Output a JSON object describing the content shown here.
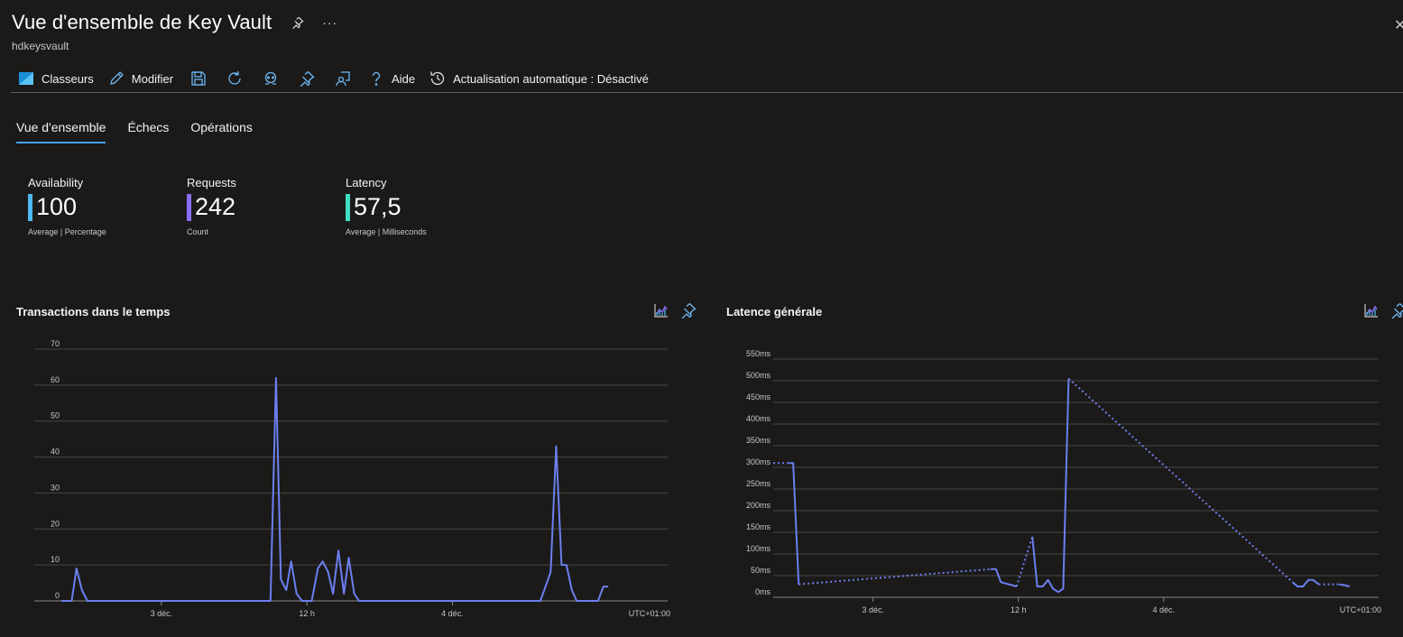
{
  "header": {
    "title": "Vue d'ensemble de Key Vault",
    "subtitle": "hdkeysvault",
    "close": "✕"
  },
  "toolbar": {
    "classeurs": "Classeurs",
    "modifier": "Modifier",
    "aide": "Aide",
    "auto_refresh": "Actualisation automatique : Désactivé"
  },
  "tabs": [
    {
      "label": "Vue d'ensemble",
      "active": true
    },
    {
      "label": "Échecs",
      "active": false
    },
    {
      "label": "Opérations",
      "active": false
    }
  ],
  "kpis": [
    {
      "label": "Availability",
      "value": "100",
      "unit": "Average | Percentage",
      "color": "#4fb8f0"
    },
    {
      "label": "Requests",
      "value": "242",
      "unit": "Count",
      "color": "#8c6cf2"
    },
    {
      "label": "Latency",
      "value": "57,5",
      "unit": "Average | Milliseconds",
      "color": "#3fe0c2"
    }
  ],
  "colors": {
    "series": "#6b7ff0",
    "grid": "#484644",
    "axis": "#8a8886"
  },
  "chart_data": [
    {
      "type": "line",
      "title": "Transactions dans le temps",
      "ylim": [
        0,
        70
      ],
      "yticks": [
        0,
        10,
        20,
        30,
        40,
        50,
        60,
        70
      ],
      "ytick_labels": [
        "0",
        "10",
        "20",
        "30",
        "40",
        "50",
        "60",
        "70"
      ],
      "xlim": [
        0,
        100
      ],
      "xticks": [
        {
          "pos": 16.5,
          "label": "3 déc."
        },
        {
          "pos": 40.5,
          "label": "12 h"
        },
        {
          "pos": 64.5,
          "label": "4 déc."
        }
      ],
      "xtick_end_label": "UTC+01:00",
      "series": [
        {
          "segments": [
            {
              "style": "solid",
              "points": [
                [
                  0,
                  0
                ],
                [
                  1.7,
                  0
                ],
                [
                  2.5,
                  9
                ],
                [
                  3.4,
                  3
                ],
                [
                  4.3,
                  0
                ],
                [
                  34.5,
                  0
                ],
                [
                  35.4,
                  62
                ],
                [
                  36.2,
                  6
                ],
                [
                  37.1,
                  3
                ],
                [
                  37.9,
                  11
                ],
                [
                  38.8,
                  2
                ],
                [
                  39.7,
                  0
                ],
                [
                  41.3,
                  0
                ],
                [
                  42.3,
                  9
                ],
                [
                  43.1,
                  11
                ],
                [
                  44,
                  8
                ],
                [
                  44.8,
                  2
                ],
                [
                  45.7,
                  14
                ],
                [
                  46.6,
                  2
                ],
                [
                  47.4,
                  12
                ],
                [
                  48.3,
                  2
                ],
                [
                  49.1,
                  0
                ],
                [
                  79,
                  0
                ],
                [
                  80.7,
                  8
                ],
                [
                  81.6,
                  43
                ],
                [
                  82.5,
                  10
                ],
                [
                  83.3,
                  10
                ],
                [
                  84.2,
                  3
                ],
                [
                  85,
                  0
                ],
                [
                  88.5,
                  0
                ],
                [
                  89.4,
                  4
                ],
                [
                  90.2,
                  4
                ]
              ]
            }
          ]
        }
      ]
    },
    {
      "type": "line",
      "title": "Latence générale",
      "ylim": [
        0,
        550
      ],
      "yticks": [
        0,
        50,
        100,
        150,
        200,
        250,
        300,
        350,
        400,
        450,
        500,
        550
      ],
      "ytick_labels": [
        "0ms",
        "50ms",
        "100ms",
        "150ms",
        "200ms",
        "250ms",
        "300ms",
        "350ms",
        "400ms",
        "450ms",
        "500ms",
        "550ms"
      ],
      "xlim": [
        0,
        100
      ],
      "xticks": [
        {
          "pos": 16.5,
          "label": "3 déc."
        },
        {
          "pos": 40.5,
          "label": "12 h"
        },
        {
          "pos": 64.5,
          "label": "4 déc."
        }
      ],
      "xtick_end_label": "UTC+01:00",
      "series": [
        {
          "segments": [
            {
              "style": "dotted",
              "points": [
                [
                  0,
                  310
                ],
                [
                  2.6,
                  310
                ]
              ]
            },
            {
              "style": "solid",
              "points": [
                [
                  2.6,
                  310
                ],
                [
                  3.3,
                  310
                ],
                [
                  4.2,
                  30
                ]
              ]
            },
            {
              "style": "dotted",
              "points": [
                [
                  4.2,
                  30
                ],
                [
                  35.9,
                  65
                ]
              ]
            },
            {
              "style": "solid",
              "points": [
                [
                  35.9,
                  65
                ],
                [
                  36.8,
                  65
                ],
                [
                  37.6,
                  35
                ],
                [
                  40.2,
                  25
                ]
              ]
            },
            {
              "style": "dotted",
              "points": [
                [
                  40.2,
                  25
                ],
                [
                  42.8,
                  140
                ]
              ]
            },
            {
              "style": "solid",
              "points": [
                [
                  42.8,
                  140
                ],
                [
                  43.6,
                  25
                ],
                [
                  44.5,
                  25
                ],
                [
                  45.4,
                  40
                ],
                [
                  46.2,
                  20
                ],
                [
                  47.1,
                  12
                ],
                [
                  47.9,
                  20
                ],
                [
                  48.8,
                  505
                ]
              ]
            },
            {
              "style": "dotted",
              "points": [
                [
                  48.8,
                  505
                ],
                [
                  85.8,
                  35
                ]
              ]
            },
            {
              "style": "solid",
              "points": [
                [
                  85.8,
                  35
                ],
                [
                  86.6,
                  25
                ],
                [
                  87.5,
                  25
                ],
                [
                  88.4,
                  40
                ],
                [
                  89.2,
                  40
                ],
                [
                  90.1,
                  30
                ]
              ]
            },
            {
              "style": "dotted",
              "points": [
                [
                  90.1,
                  30
                ],
                [
                  93.5,
                  30
                ]
              ]
            },
            {
              "style": "solid",
              "points": [
                [
                  93.5,
                  30
                ],
                [
                  94.4,
                  28
                ],
                [
                  95.2,
                  25
                ]
              ]
            }
          ]
        }
      ]
    }
  ]
}
